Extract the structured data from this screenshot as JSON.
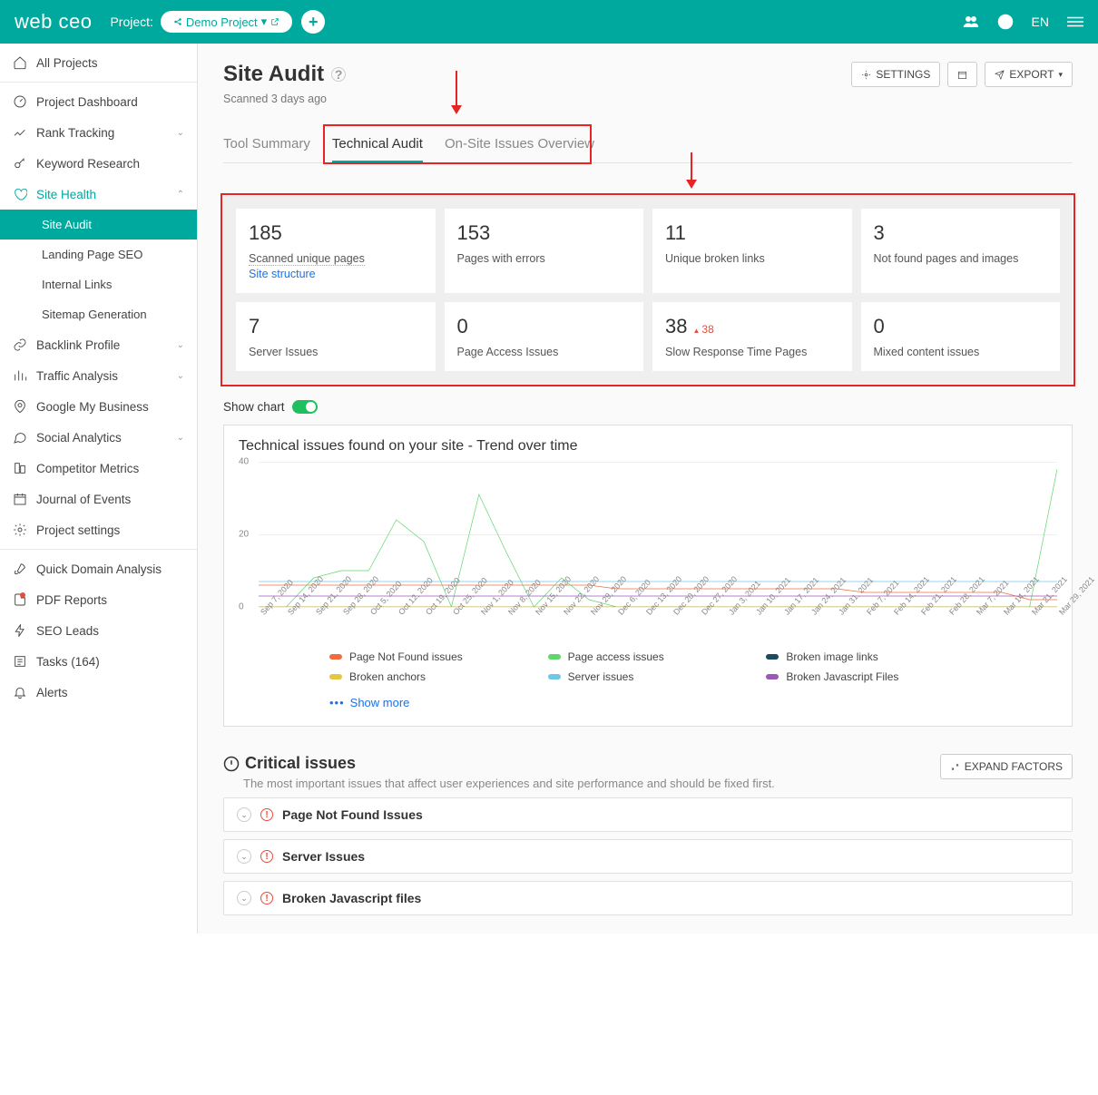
{
  "topbar": {
    "logo": "web ceo",
    "project_label": "Project:",
    "project_name": "Demo Project",
    "lang": "EN"
  },
  "sidebar": {
    "all_projects": "All Projects",
    "items": [
      {
        "label": "Project Dashboard"
      },
      {
        "label": "Rank Tracking",
        "chev": true
      },
      {
        "label": "Keyword Research"
      },
      {
        "label": "Site Health",
        "chev": true,
        "open": true,
        "children": [
          {
            "label": "Site Audit",
            "active": true
          },
          {
            "label": "Landing Page SEO"
          },
          {
            "label": "Internal Links"
          },
          {
            "label": "Sitemap Generation"
          }
        ]
      },
      {
        "label": "Backlink Profile",
        "chev": true
      },
      {
        "label": "Traffic Analysis",
        "chev": true
      },
      {
        "label": "Google My Business"
      },
      {
        "label": "Social Analytics",
        "chev": true
      },
      {
        "label": "Competitor Metrics"
      },
      {
        "label": "Journal of Events"
      },
      {
        "label": "Project settings"
      }
    ],
    "bottom": [
      {
        "label": "Quick Domain Analysis"
      },
      {
        "label": "PDF Reports",
        "dot": true
      },
      {
        "label": "SEO Leads"
      },
      {
        "label": "Tasks (164)"
      },
      {
        "label": "Alerts"
      }
    ]
  },
  "page": {
    "title": "Site Audit",
    "scanned": "Scanned 3 days ago",
    "settings_btn": "SETTINGS",
    "export_btn": "EXPORT"
  },
  "tabs": {
    "summary": "Tool Summary",
    "technical": "Technical Audit",
    "onsite": "On-Site Issues Overview"
  },
  "cards": [
    {
      "value": "185",
      "label": "Scanned unique pages",
      "link": "Site structure"
    },
    {
      "value": "153",
      "label": "Pages with errors"
    },
    {
      "value": "11",
      "label": "Unique broken links"
    },
    {
      "value": "3",
      "label": "Not found pages and images"
    },
    {
      "value": "7",
      "label": "Server Issues"
    },
    {
      "value": "0",
      "label": "Page Access Issues"
    },
    {
      "value": "38",
      "delta": "38",
      "label": "Slow Response Time Pages"
    },
    {
      "value": "0",
      "label": "Mixed content issues"
    }
  ],
  "show_chart_label": "Show chart",
  "chart_title": "Technical issues found on your site - Trend over time",
  "chart_data": {
    "type": "line",
    "ylim": [
      0,
      40
    ],
    "yticks": [
      0,
      20,
      40
    ],
    "categories": [
      "Sep 7, 2020",
      "Sep 14, 2020",
      "Sep 21, 2020",
      "Sep 28, 2020",
      "Oct 5, 2020",
      "Oct 12, 2020",
      "Oct 19, 2020",
      "Oct 25, 2020",
      "Nov 1, 2020",
      "Nov 8, 2020",
      "Nov 15, 2020",
      "Nov 22, 2020",
      "Nov 29, 2020",
      "Dec 6, 2020",
      "Dec 13, 2020",
      "Dec 20, 2020",
      "Dec 27, 2020",
      "Jan 3, 2021",
      "Jan 10, 2021",
      "Jan 17, 2021",
      "Jan 24, 2021",
      "Jan 31, 2021",
      "Feb 7, 2021",
      "Feb 14, 2021",
      "Feb 21, 2021",
      "Feb 28, 2021",
      "Mar 7, 2021",
      "Mar 14, 2021",
      "Mar 21, 2021",
      "Mar 29, 2021"
    ],
    "series": [
      {
        "name": "Page Not Found issues",
        "color": "#f06c3c",
        "values": [
          6,
          6,
          6,
          6,
          6,
          6,
          6,
          6,
          6,
          6,
          6,
          6,
          6,
          5,
          5,
          5,
          5,
          5,
          5,
          5,
          5,
          5,
          4,
          4,
          4,
          4,
          4,
          4,
          2,
          2
        ]
      },
      {
        "name": "Page access issues",
        "color": "#5fd66a",
        "values": [
          0,
          0,
          8,
          10,
          10,
          24,
          18,
          0,
          31,
          15,
          0,
          8,
          2,
          0,
          0,
          0,
          0,
          0,
          0,
          0,
          0,
          0,
          0,
          0,
          0,
          0,
          0,
          0,
          0,
          38
        ]
      },
      {
        "name": "Broken image links",
        "color": "#1c4a60",
        "values": [
          0,
          0,
          0,
          0,
          0,
          0,
          0,
          0,
          0,
          0,
          0,
          0,
          0,
          0,
          0,
          0,
          0,
          0,
          0,
          0,
          0,
          0,
          0,
          0,
          0,
          0,
          0,
          0,
          0,
          0
        ]
      },
      {
        "name": "Broken anchors",
        "color": "#e6c544",
        "values": [
          0,
          0,
          0,
          0,
          0,
          0,
          0,
          0,
          0,
          0,
          0,
          0,
          0,
          0,
          0,
          0,
          0,
          0,
          0,
          0,
          0,
          0,
          0,
          0,
          0,
          0,
          0,
          0,
          0,
          0
        ]
      },
      {
        "name": "Server issues",
        "color": "#6fc7e6",
        "values": [
          7,
          7,
          7,
          7,
          7,
          7,
          7,
          7,
          7,
          7,
          7,
          7,
          7,
          7,
          7,
          7,
          7,
          7,
          7,
          7,
          7,
          7,
          7,
          7,
          7,
          7,
          7,
          7,
          7,
          7
        ]
      },
      {
        "name": "Broken Javascript Files",
        "color": "#9b59b6",
        "values": [
          3,
          3,
          3,
          3,
          3,
          3,
          3,
          3,
          3,
          3,
          3,
          3,
          3,
          3,
          3,
          3,
          3,
          3,
          3,
          3,
          3,
          3,
          3,
          3,
          3,
          3,
          3,
          3,
          3,
          3
        ]
      }
    ]
  },
  "show_more": "Show more",
  "critical": {
    "title": "Critical issues",
    "sub": "The most important issues that affect user experiences and site performance and should be fixed first.",
    "expand": "EXPAND FACTORS",
    "issues": [
      {
        "label": "Page Not Found Issues"
      },
      {
        "label": "Server Issues"
      },
      {
        "label": "Broken Javascript files"
      }
    ]
  }
}
